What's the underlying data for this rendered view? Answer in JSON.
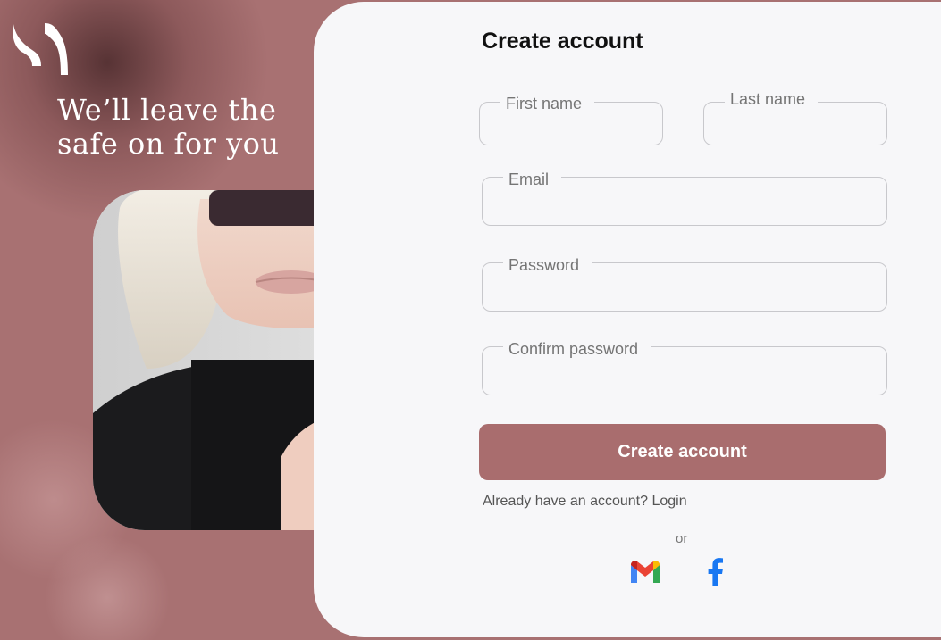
{
  "hero": {
    "tagline": "We’ll leave the safe on for you"
  },
  "form": {
    "title": "Create account",
    "fields": {
      "first_name": {
        "label": "First name",
        "value": ""
      },
      "last_name": {
        "label": "Last name",
        "value": ""
      },
      "email": {
        "label": "Email",
        "value": ""
      },
      "password": {
        "label": "Password",
        "value": ""
      },
      "confirm_password": {
        "label": "Confirm password",
        "value": ""
      }
    },
    "submit_label": "Create account",
    "login_prompt": "Already have an account? Login",
    "divider_text": "or"
  },
  "social": {
    "gmail": {
      "icon": "gmail-icon"
    },
    "facebook": {
      "icon": "facebook-icon"
    }
  },
  "colors": {
    "brand": "#a96d6e",
    "background": "#a87172",
    "card": "#f7f7f9",
    "facebook": "#1877f2"
  }
}
